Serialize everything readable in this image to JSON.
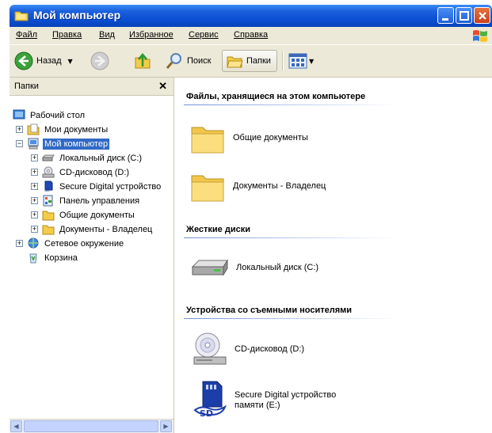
{
  "window": {
    "title": "Мой компьютер"
  },
  "menu": [
    "Файл",
    "Правка",
    "Вид",
    "Избранное",
    "Сервис",
    "Справка"
  ],
  "toolbar": {
    "back_label": "Назад",
    "search_label": "Поиск",
    "folders_label": "Папки"
  },
  "folders_pane": {
    "title": "Папки",
    "close_glyph": "✕",
    "tree": [
      {
        "label": "Рабочий стол"
      },
      {
        "label": "Мои документы"
      },
      {
        "label": "Мой компьютер"
      },
      {
        "label": "Локальный диск (C:)"
      },
      {
        "label": "CD-дисковод (D:)"
      },
      {
        "label": "Secure Digital устройство"
      },
      {
        "label": "Панель управления"
      },
      {
        "label": "Общие документы"
      },
      {
        "label": "Документы - Владелец"
      },
      {
        "label": "Сетевое окружение"
      },
      {
        "label": "Корзина"
      }
    ]
  },
  "content": {
    "groups": [
      {
        "title": "Файлы, хранящиеся на этом компьютере",
        "items": [
          "Общие документы",
          "Документы - Владелец"
        ]
      },
      {
        "title": "Жесткие диски",
        "items": [
          "Локальный диск (C:)"
        ]
      },
      {
        "title": "Устройства со съемными носителями",
        "items": [
          "CD-дисковод (D:)",
          "Secure Digital устройство памяти (E:)"
        ]
      }
    ]
  },
  "colors": {
    "titlebar": "#0a4ed2",
    "selection": "#316ac5",
    "chrome": "#ece9d8"
  }
}
